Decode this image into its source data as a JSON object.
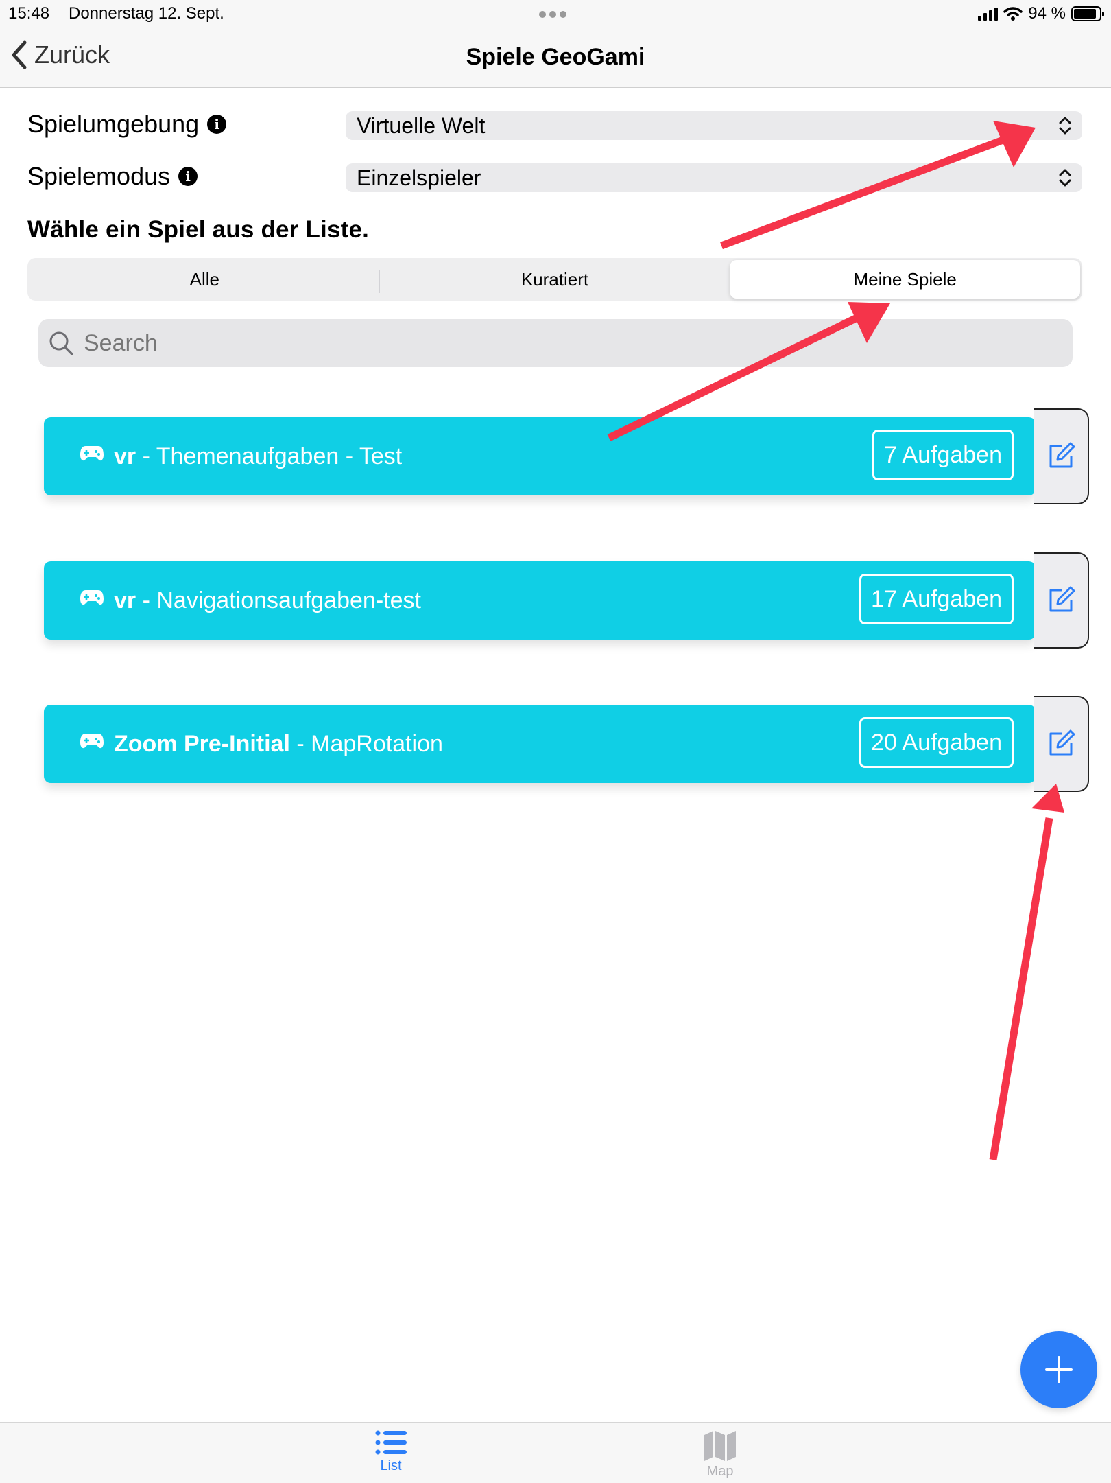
{
  "status_bar": {
    "time": "15:48",
    "date": "Donnerstag 12. Sept.",
    "battery": "94 %"
  },
  "nav": {
    "back_label": "Zurück",
    "title": "Spiele GeoGami"
  },
  "form": {
    "environment_label": "Spielumgebung",
    "environment_value": "Virtuelle Welt",
    "mode_label": "Spielemodus",
    "mode_value": "Einzelspieler"
  },
  "instruction": "Wähle ein Spiel aus der Liste.",
  "segments": [
    {
      "label": "Alle",
      "selected": false
    },
    {
      "label": "Kuratiert",
      "selected": false
    },
    {
      "label": "Meine Spiele",
      "selected": true
    }
  ],
  "search": {
    "placeholder": "Search",
    "value": ""
  },
  "games": [
    {
      "prefix": "vr",
      "separator": " - ",
      "name": "Themenaufgaben - Test",
      "tasks": "7 Aufgaben"
    },
    {
      "prefix": "vr",
      "separator": " - ",
      "name": "Navigationsaufgaben-test",
      "tasks": "17 Aufgaben"
    },
    {
      "prefix": "Zoom Pre-Initial",
      "separator": " - ",
      "name": "MapRotation",
      "tasks": "20 Aufgaben"
    }
  ],
  "tabs": [
    {
      "label": "List",
      "active": true,
      "icon": "list-icon"
    },
    {
      "label": "Map",
      "active": false,
      "icon": "map-icon"
    }
  ],
  "colors": {
    "card": "#10cfe5",
    "accent": "#2c7ef8",
    "annotation_arrow": "#f5344a"
  }
}
